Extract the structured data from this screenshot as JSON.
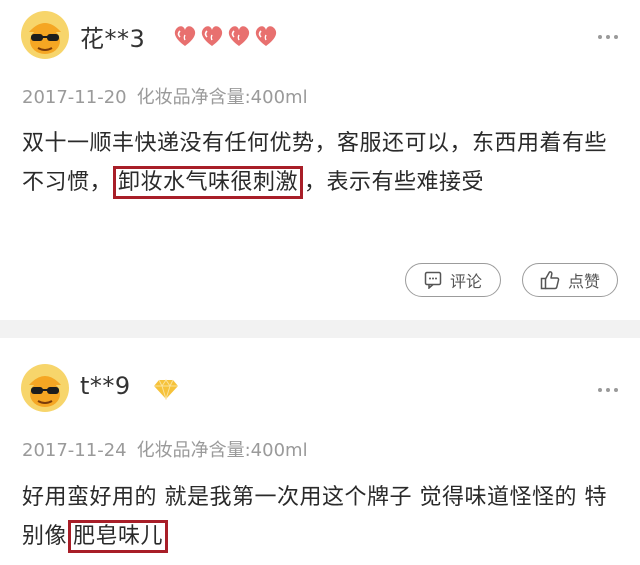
{
  "reviews": [
    {
      "username": "花**3",
      "level_icon": "heart-level-icon",
      "level_count": 4,
      "date": "2017-11-20",
      "spec": "化妆品净含量:400ml",
      "content_before": "双十一顺丰快递没有任何优势，客服还可以，东西用着有些不习惯，",
      "content_highlight": "卸妆水气味很刺激",
      "content_after": "，表示有些难接受",
      "comment_label": "评论",
      "like_label": "点赞"
    },
    {
      "username": "t**9",
      "level_icon": "diamond-level-icon",
      "date": "2017-11-24",
      "spec": "化妆品净含量:400ml",
      "content_before": "好用蛮好用的 就是我第一次用这个牌子 觉得味道怪怪的 特别像",
      "content_highlight": "肥皂味儿",
      "content_after": ""
    }
  ],
  "colors": {
    "highlight_border": "#a81e28",
    "meta_text": "#9a9a9a",
    "separator": "#f2f2f2",
    "heart": "#e8706f",
    "diamond": "#f6c23a"
  }
}
